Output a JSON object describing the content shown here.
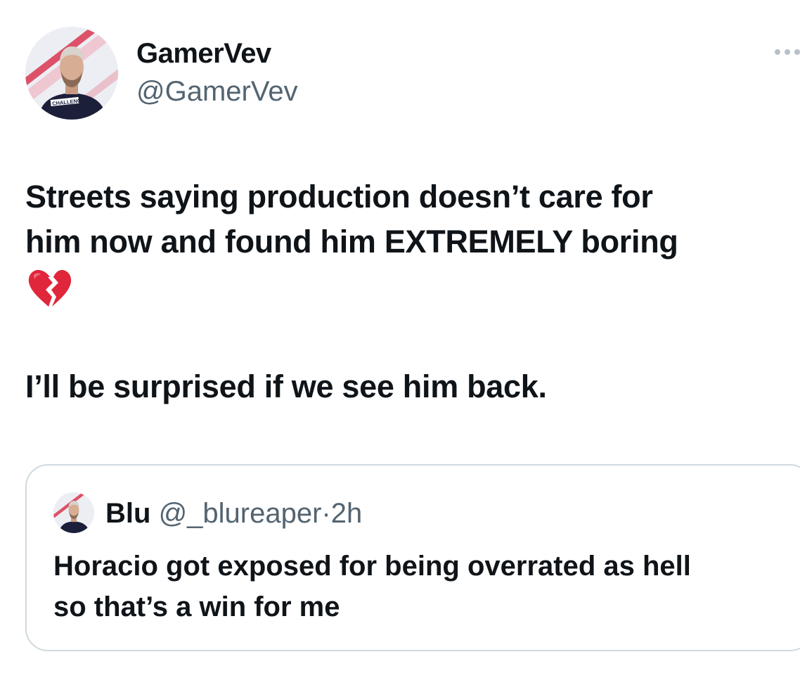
{
  "author": {
    "display_name": "GamerVev",
    "handle": "@GamerVev",
    "avatar_icon": "avatar-photo",
    "avatar_shirt_text": "CHALLENGE"
  },
  "more_icon": "more-horizontal-icon",
  "tweet": {
    "line1": "Streets saying production doesn’t care for",
    "line2": "him now and found him EXTREMELY boring",
    "emoji": "💔",
    "line3": "I’ll be surprised if we see him back."
  },
  "quote": {
    "display_name": "Blu",
    "handle": "@_blureaper",
    "separator": "·",
    "time": "2h",
    "line1": "Horacio got exposed for being overrated as hell",
    "line2": "so that’s a win for me"
  },
  "colors": {
    "text": "#0f1419",
    "secondary": "#536471",
    "border": "#cfd9de",
    "heart": "#e0263b"
  }
}
